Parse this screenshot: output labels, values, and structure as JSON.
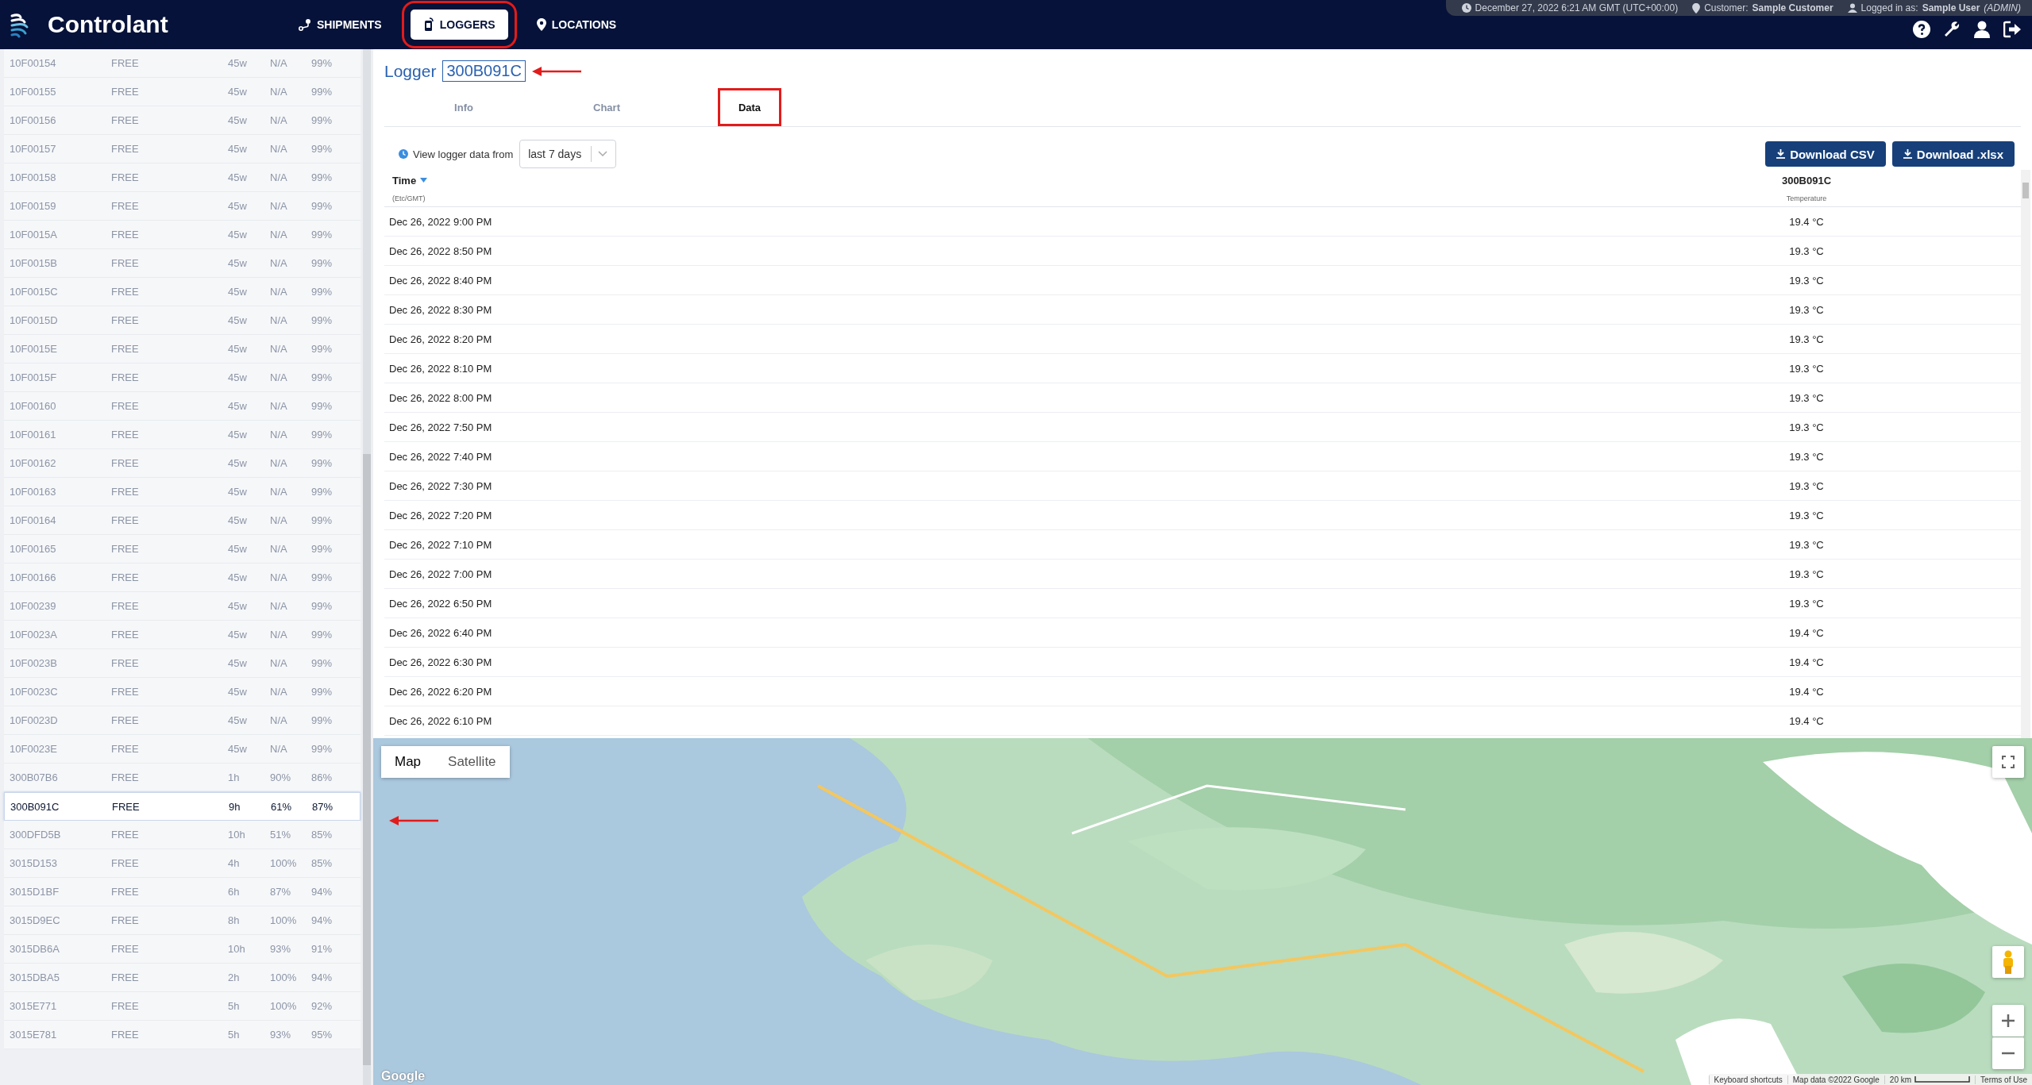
{
  "header": {
    "brand": "Controlant",
    "nav": [
      {
        "label": "SHIPMENTS",
        "kind": "route",
        "selected": false
      },
      {
        "label": "LOGGERS",
        "kind": "device",
        "selected": true
      },
      {
        "label": "LOCATIONS",
        "kind": "pin",
        "selected": false
      }
    ],
    "info": {
      "datetime": "December 27, 2022 6:21 AM GMT (UTC+00:00)",
      "customer_label": "Customer:",
      "customer": "Sample Customer",
      "login_label": "Logged in as:",
      "user": "Sample User",
      "role": "(ADMIN)"
    }
  },
  "logger_list": [
    {
      "id": "10F00154",
      "status": "FREE",
      "column_3": "45w",
      "column_4": "N/A",
      "column_5": "99%",
      "selected": false
    },
    {
      "id": "10F00155",
      "status": "FREE",
      "column_3": "45w",
      "column_4": "N/A",
      "column_5": "99%",
      "selected": false
    },
    {
      "id": "10F00156",
      "status": "FREE",
      "column_3": "45w",
      "column_4": "N/A",
      "column_5": "99%",
      "selected": false
    },
    {
      "id": "10F00157",
      "status": "FREE",
      "column_3": "45w",
      "column_4": "N/A",
      "column_5": "99%",
      "selected": false
    },
    {
      "id": "10F00158",
      "status": "FREE",
      "column_3": "45w",
      "column_4": "N/A",
      "column_5": "99%",
      "selected": false
    },
    {
      "id": "10F00159",
      "status": "FREE",
      "column_3": "45w",
      "column_4": "N/A",
      "column_5": "99%",
      "selected": false
    },
    {
      "id": "10F0015A",
      "status": "FREE",
      "column_3": "45w",
      "column_4": "N/A",
      "column_5": "99%",
      "selected": false
    },
    {
      "id": "10F0015B",
      "status": "FREE",
      "column_3": "45w",
      "column_4": "N/A",
      "column_5": "99%",
      "selected": false
    },
    {
      "id": "10F0015C",
      "status": "FREE",
      "column_3": "45w",
      "column_4": "N/A",
      "column_5": "99%",
      "selected": false
    },
    {
      "id": "10F0015D",
      "status": "FREE",
      "column_3": "45w",
      "column_4": "N/A",
      "column_5": "99%",
      "selected": false
    },
    {
      "id": "10F0015E",
      "status": "FREE",
      "column_3": "45w",
      "column_4": "N/A",
      "column_5": "99%",
      "selected": false
    },
    {
      "id": "10F0015F",
      "status": "FREE",
      "column_3": "45w",
      "column_4": "N/A",
      "column_5": "99%",
      "selected": false
    },
    {
      "id": "10F00160",
      "status": "FREE",
      "column_3": "45w",
      "column_4": "N/A",
      "column_5": "99%",
      "selected": false
    },
    {
      "id": "10F00161",
      "status": "FREE",
      "column_3": "45w",
      "column_4": "N/A",
      "column_5": "99%",
      "selected": false
    },
    {
      "id": "10F00162",
      "status": "FREE",
      "column_3": "45w",
      "column_4": "N/A",
      "column_5": "99%",
      "selected": false
    },
    {
      "id": "10F00163",
      "status": "FREE",
      "column_3": "45w",
      "column_4": "N/A",
      "column_5": "99%",
      "selected": false
    },
    {
      "id": "10F00164",
      "status": "FREE",
      "column_3": "45w",
      "column_4": "N/A",
      "column_5": "99%",
      "selected": false
    },
    {
      "id": "10F00165",
      "status": "FREE",
      "column_3": "45w",
      "column_4": "N/A",
      "column_5": "99%",
      "selected": false
    },
    {
      "id": "10F00166",
      "status": "FREE",
      "column_3": "45w",
      "column_4": "N/A",
      "column_5": "99%",
      "selected": false
    },
    {
      "id": "10F00239",
      "status": "FREE",
      "column_3": "45w",
      "column_4": "N/A",
      "column_5": "99%",
      "selected": false
    },
    {
      "id": "10F0023A",
      "status": "FREE",
      "column_3": "45w",
      "column_4": "N/A",
      "column_5": "99%",
      "selected": false
    },
    {
      "id": "10F0023B",
      "status": "FREE",
      "column_3": "45w",
      "column_4": "N/A",
      "column_5": "99%",
      "selected": false
    },
    {
      "id": "10F0023C",
      "status": "FREE",
      "column_3": "45w",
      "column_4": "N/A",
      "column_5": "99%",
      "selected": false
    },
    {
      "id": "10F0023D",
      "status": "FREE",
      "column_3": "45w",
      "column_4": "N/A",
      "column_5": "99%",
      "selected": false
    },
    {
      "id": "10F0023E",
      "status": "FREE",
      "column_3": "45w",
      "column_4": "N/A",
      "column_5": "99%",
      "selected": false
    },
    {
      "id": "300B07B6",
      "status": "FREE",
      "column_3": "1h",
      "column_4": "90%",
      "column_5": "86%",
      "selected": false
    },
    {
      "id": "300B091C",
      "status": "FREE",
      "column_3": "9h",
      "column_4": "61%",
      "column_5": "87%",
      "selected": true
    },
    {
      "id": "300DFD5B",
      "status": "FREE",
      "column_3": "10h",
      "column_4": "51%",
      "column_5": "85%",
      "selected": false
    },
    {
      "id": "3015D153",
      "status": "FREE",
      "column_3": "4h",
      "column_4": "100%",
      "column_5": "85%",
      "selected": false
    },
    {
      "id": "3015D1BF",
      "status": "FREE",
      "column_3": "6h",
      "column_4": "87%",
      "column_5": "94%",
      "selected": false
    },
    {
      "id": "3015D9EC",
      "status": "FREE",
      "column_3": "8h",
      "column_4": "100%",
      "column_5": "94%",
      "selected": false
    },
    {
      "id": "3015DB6A",
      "status": "FREE",
      "column_3": "10h",
      "column_4": "93%",
      "column_5": "91%",
      "selected": false
    },
    {
      "id": "3015DBA5",
      "status": "FREE",
      "column_3": "2h",
      "column_4": "100%",
      "column_5": "94%",
      "selected": false
    },
    {
      "id": "3015E771",
      "status": "FREE",
      "column_3": "5h",
      "column_4": "100%",
      "column_5": "92%",
      "selected": false
    },
    {
      "id": "3015E781",
      "status": "FREE",
      "column_3": "5h",
      "column_4": "93%",
      "column_5": "95%",
      "selected": false
    }
  ],
  "logger": {
    "label": "Logger",
    "id": "300B091C",
    "tabs": [
      {
        "label": "Info",
        "selected": false
      },
      {
        "label": "Chart",
        "selected": false
      },
      {
        "label": "Data",
        "selected": true
      }
    ],
    "range_label": "View logger data from",
    "range": "last 7 days",
    "buttons": [
      "Download CSV",
      "Download .xlsx"
    ],
    "table": {
      "columns": [
        {
          "title": "Time",
          "subtitle": "(Etc/GMT)"
        },
        {
          "title": "300B091C",
          "subtitle": "Temperature"
        }
      ],
      "rows": [
        [
          "Dec 26, 2022 9:00 PM",
          "19.4 °C"
        ],
        [
          "Dec 26, 2022 8:50 PM",
          "19.3 °C"
        ],
        [
          "Dec 26, 2022 8:40 PM",
          "19.3 °C"
        ],
        [
          "Dec 26, 2022 8:30 PM",
          "19.3 °C"
        ],
        [
          "Dec 26, 2022 8:20 PM",
          "19.3 °C"
        ],
        [
          "Dec 26, 2022 8:10 PM",
          "19.3 °C"
        ],
        [
          "Dec 26, 2022 8:00 PM",
          "19.3 °C"
        ],
        [
          "Dec 26, 2022 7:50 PM",
          "19.3 °C"
        ],
        [
          "Dec 26, 2022 7:40 PM",
          "19.3 °C"
        ],
        [
          "Dec 26, 2022 7:30 PM",
          "19.3 °C"
        ],
        [
          "Dec 26, 2022 7:20 PM",
          "19.3 °C"
        ],
        [
          "Dec 26, 2022 7:10 PM",
          "19.3 °C"
        ],
        [
          "Dec 26, 2022 7:00 PM",
          "19.3 °C"
        ],
        [
          "Dec 26, 2022 6:50 PM",
          "19.3 °C"
        ],
        [
          "Dec 26, 2022 6:40 PM",
          "19.4 °C"
        ],
        [
          "Dec 26, 2022 6:30 PM",
          "19.4 °C"
        ],
        [
          "Dec 26, 2022 6:20 PM",
          "19.4 °C"
        ],
        [
          "Dec 26, 2022 6:10 PM",
          "19.4 °C"
        ]
      ]
    }
  },
  "map": {
    "types": [
      {
        "label": "Map",
        "selected": true
      },
      {
        "label": "Satellite",
        "selected": false
      }
    ],
    "logo": "Google",
    "footer": [
      "Keyboard shortcuts",
      "Map data ©2022 Google",
      "20 km",
      "Terms of Use"
    ]
  }
}
